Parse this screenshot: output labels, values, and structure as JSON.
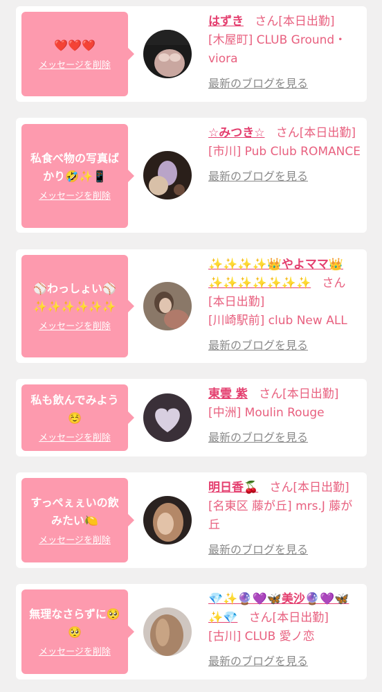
{
  "cards": [
    {
      "message": "❤️❤️❤️",
      "delete_label": "メッセージを削除",
      "name": "はずき",
      "honorific": "さん[本日出勤]",
      "shop": "[木屋町] CLUB Ground・viora",
      "blog_label": "最新のブログを見る"
    },
    {
      "message": "私食べ物の写真ばかり🤣✨📱",
      "delete_label": "メッセージを削除",
      "name": "☆みつき☆",
      "honorific": "さん[本日出勤]",
      "shop": "[市川] Pub Club ROMANCE",
      "blog_label": "最新のブログを見る"
    },
    {
      "message": "⚾わっしょい⚾✨✨✨✨✨✨",
      "delete_label": "メッセージを削除",
      "name": "✨✨✨✨👑やよママ👑✨✨✨✨✨✨✨",
      "honorific": "さん[本日出勤]",
      "shop": "[川崎駅前] club New ALL",
      "blog_label": "最新のブログを見る"
    },
    {
      "message": "私も飲んでみよう☺️",
      "delete_label": "メッセージを削除",
      "name": "東雲 紫",
      "honorific": "さん[本日出勤]",
      "shop": "[中洲] Moulin Rouge",
      "blog_label": "最新のブログを見る"
    },
    {
      "message": "すっぺぇぇいの飲みたい🍋",
      "delete_label": "メッセージを削除",
      "name": "明日香🍒",
      "honorific": "さん[本日出勤]",
      "shop": "[名東区 藤が丘] mrs.J 藤が丘",
      "blog_label": "最新のブログを見る"
    },
    {
      "message": "無理なさらずに🥺🥺",
      "delete_label": "メッセージを削除",
      "name": "💎✨🔮💜🦋美沙🔮💜🦋✨💎",
      "honorific": "さん[本日出勤]",
      "shop": "[古川] CLUB 愛ノ恋",
      "blog_label": "最新のブログを見る"
    }
  ],
  "colors": {
    "background": "#f1f0f0",
    "bubble": "#fd9aae",
    "name": "#e43f6f",
    "text_pink": "#e8607f",
    "link_gray": "#8a8a8a"
  }
}
